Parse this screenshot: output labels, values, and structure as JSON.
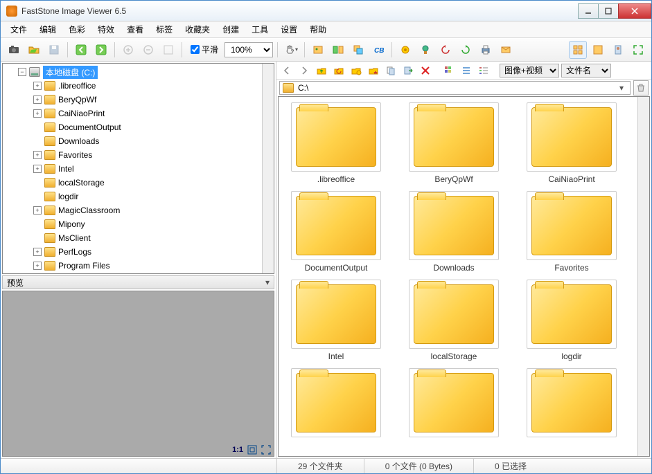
{
  "title": "FastStone Image Viewer 6.5",
  "menu": [
    "文件",
    "编辑",
    "色彩",
    "特效",
    "查看",
    "标签",
    "收藏夹",
    "创建",
    "工具",
    "设置",
    "帮助"
  ],
  "toolbar": {
    "smooth_label": "平滑",
    "zoom_value": "100%"
  },
  "tree": {
    "root_label": "本地磁盘 (C:)",
    "items": [
      {
        "label": ".libreoffice",
        "expandable": true
      },
      {
        "label": "BeryQpWf",
        "expandable": true
      },
      {
        "label": "CaiNiaoPrint",
        "expandable": true
      },
      {
        "label": "DocumentOutput",
        "expandable": false
      },
      {
        "label": "Downloads",
        "expandable": false
      },
      {
        "label": "Favorites",
        "expandable": true
      },
      {
        "label": "Intel",
        "expandable": true
      },
      {
        "label": "localStorage",
        "expandable": false
      },
      {
        "label": "logdir",
        "expandable": false
      },
      {
        "label": "MagicClassroom",
        "expandable": true
      },
      {
        "label": "Mipony",
        "expandable": false
      },
      {
        "label": "MsClient",
        "expandable": false
      },
      {
        "label": "PerfLogs",
        "expandable": true
      },
      {
        "label": "Program Files",
        "expandable": true
      }
    ]
  },
  "preview": {
    "header": "预览",
    "ratio": "1:1"
  },
  "nav": {
    "filter_value": "图像+视频",
    "sort_value": "文件名"
  },
  "path": "C:\\",
  "thumbnails": [
    ".libreoffice",
    "BeryQpWf",
    "CaiNiaoPrint",
    "DocumentOutput",
    "Downloads",
    "Favorites",
    "Intel",
    "localStorage",
    "logdir",
    "",
    "",
    ""
  ],
  "status": {
    "folders": "29 个文件夹",
    "files": "0 个文件 (0 Bytes)",
    "selected": "0 已选择"
  }
}
